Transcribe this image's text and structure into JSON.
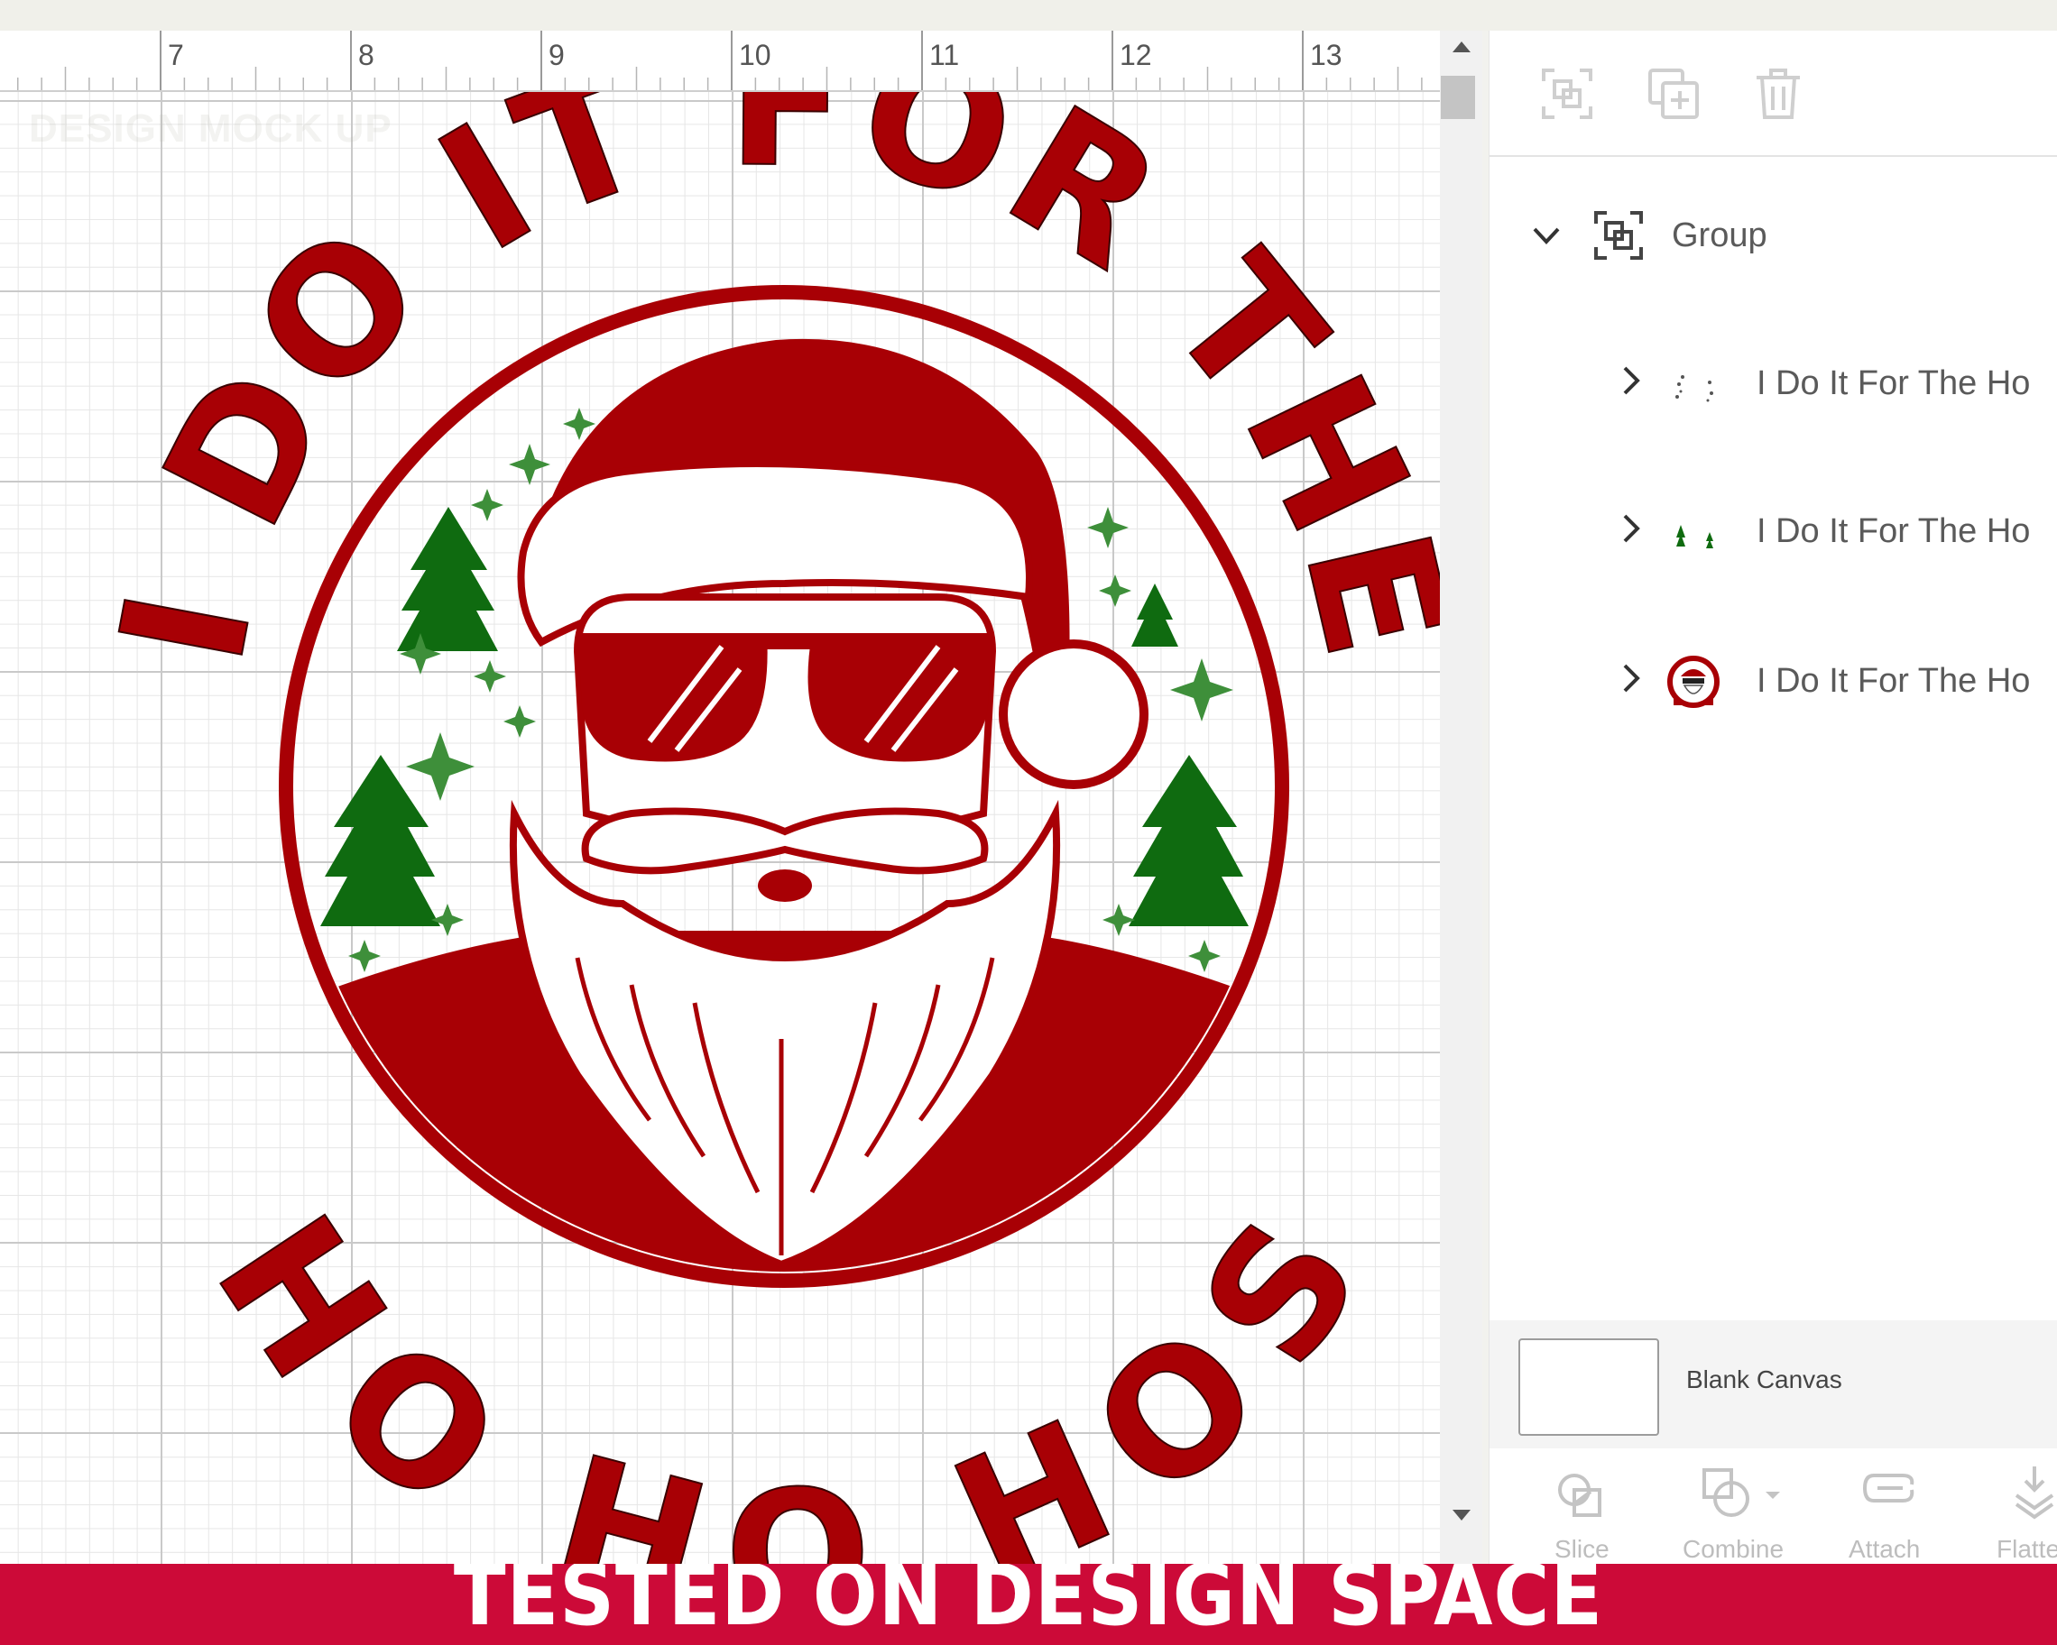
{
  "ruler": {
    "numbers": [
      "7",
      "8",
      "9",
      "10",
      "11",
      "12",
      "13"
    ]
  },
  "canvas": {
    "watermark": "DESIGN MOCK UP",
    "artwork": {
      "top_text": "I DO IT FOR THE",
      "bottom_text": "HO HO HOS"
    },
    "colors": {
      "red": "#a80005",
      "green": "#0f6b10",
      "light_green": "#3e8f3a"
    }
  },
  "layers_panel": {
    "toolbar_icons": [
      "group-icon",
      "duplicate-icon",
      "delete-icon"
    ],
    "group_label": "Group",
    "layers": [
      {
        "label": "I Do It For The Ho",
        "thumb": "white-sparkles-thumbnail"
      },
      {
        "label": "I Do It For The Ho",
        "thumb": "green-details-thumbnail"
      },
      {
        "label": "I Do It For The Ho",
        "thumb": "santa-design-thumbnail"
      }
    ],
    "blank_canvas_label": "Blank Canvas",
    "bottom_tools": {
      "slice": "Slice",
      "combine": "Combine",
      "attach": "Attach",
      "flatten": "Flatte"
    }
  },
  "banner": {
    "text": "TESTED ON DESIGN SPACE",
    "color": "#cc0a38"
  }
}
